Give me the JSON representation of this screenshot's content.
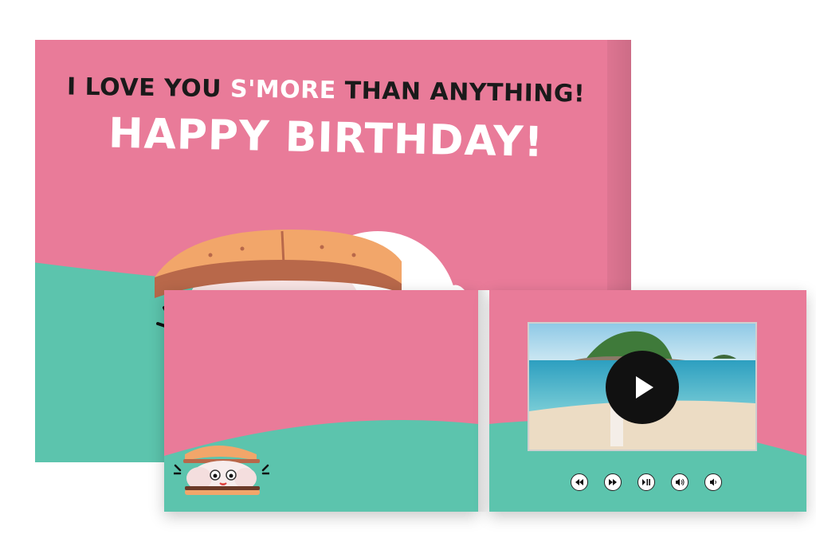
{
  "card": {
    "headline_part1": "I LOVE YOU ",
    "headline_accent": "S'MORE",
    "headline_part2": " THAN ANYTHING!",
    "greeting": "HAPPY BIRTHDAY!"
  },
  "colors": {
    "pink": "#e97b99",
    "teal": "#5cc4ad",
    "accent_text": "#ffffff",
    "dark_text": "#1a1a1a"
  },
  "video_player": {
    "controls": [
      {
        "name": "rewind-icon"
      },
      {
        "name": "fast-forward-icon"
      },
      {
        "name": "play-pause-icon"
      },
      {
        "name": "volume-up-icon"
      },
      {
        "name": "volume-down-icon"
      }
    ]
  }
}
